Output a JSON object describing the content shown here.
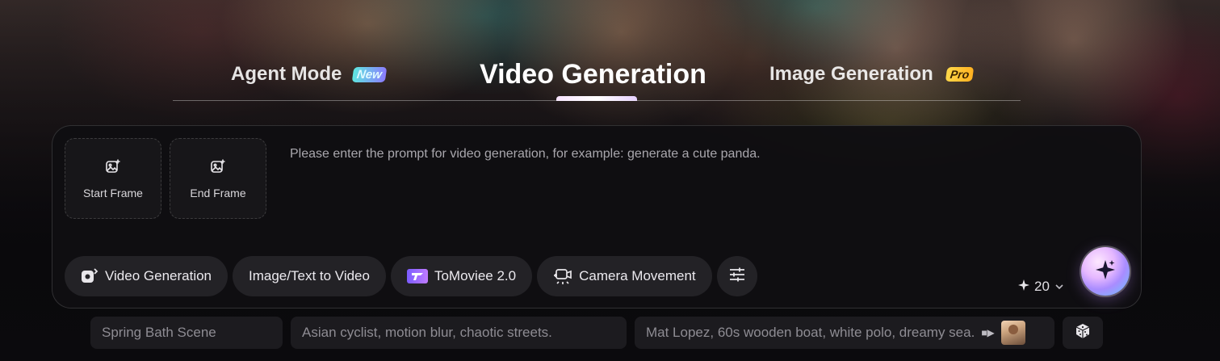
{
  "mode_tabs": {
    "agent": {
      "label": "Agent Mode",
      "badge": "New"
    },
    "video": {
      "label": "Video Generation",
      "active": true
    },
    "image": {
      "label": "Image Generation",
      "badge": "Pro"
    }
  },
  "frames": {
    "start_label": "Start Frame",
    "end_label": "End Frame"
  },
  "prompt": {
    "placeholder": "Please enter the prompt for video generation, for example: generate a cute panda.",
    "value": ""
  },
  "toolbar": {
    "video_generation": "Video Generation",
    "image_text_to_video": "Image/Text to Video",
    "model": "ToMoviee 2.0",
    "camera_movement": "Camera Movement"
  },
  "credits": {
    "value": "20"
  },
  "suggestions": [
    "Spring Bath Scene",
    "Asian cyclist, motion blur, chaotic streets.",
    "Mat Lopez, 60s wooden boat, white polo, dreamy sea."
  ],
  "colors": {
    "background": "#0b0a0d",
    "panel": "#100f12",
    "chip": "#232226",
    "accent": "#a98cff"
  },
  "icons": {
    "frame": "image-add-icon",
    "video": "video-camera-icon",
    "model": "tomoviee-logo-icon",
    "camera": "camera-movement-icon",
    "settings": "sliders-icon",
    "credits": "sparkle-icon",
    "generate": "sparkle-generate-icon",
    "random": "dice-icon"
  }
}
